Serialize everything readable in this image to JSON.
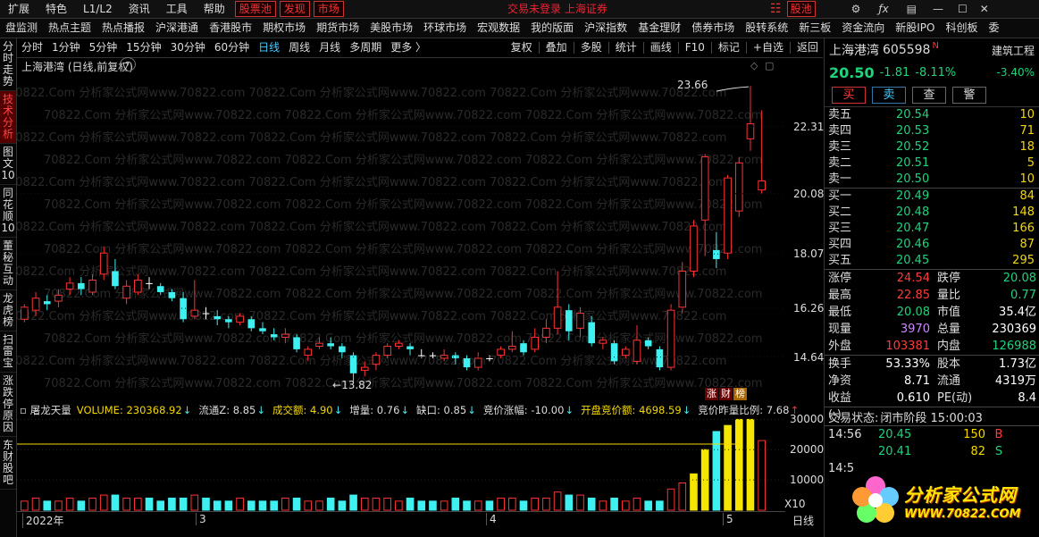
{
  "menu": {
    "items": [
      "扩展",
      "特色",
      "L1/L2",
      "资讯",
      "工具",
      "帮助"
    ],
    "boxed": [
      "股票池",
      "发现",
      "市场"
    ],
    "center_status": "交易未登录  上海证券",
    "right_label": "股池"
  },
  "nav": [
    "盘监测",
    "热点主题",
    "热点播报",
    "沪深港通",
    "香港股市",
    "期权市场",
    "期货市场",
    "美股市场",
    "环球市场",
    "宏观数据",
    "我的版面",
    "沪深指数",
    "基金理财",
    "债券市场",
    "股转系统",
    "新三板",
    "资金流向",
    "新股IPO",
    "科创板",
    "委"
  ],
  "left_tabs": [
    "分时走势",
    "技术分析",
    "图文10",
    "同花顺10",
    "董秘互动",
    "龙虎榜",
    "扫雷宝",
    "涨跌停原因",
    "东财股吧"
  ],
  "toolbar": {
    "periods": [
      "分时",
      "1分钟",
      "5分钟",
      "15分钟",
      "30分钟",
      "60分钟",
      "日线",
      "周线",
      "月线",
      "多周期",
      "更多 〉"
    ],
    "selected": "日线",
    "actions": [
      "复权",
      "叠加",
      "多股",
      "统计",
      "画线",
      "F10",
      "标记",
      "+自选",
      "返回"
    ]
  },
  "chart": {
    "title": "上海港湾 (日线,前复权)",
    "high_label": "23.66",
    "low_label": "13.82",
    "price_ticks": [
      "22.31",
      "20.08",
      "18.07",
      "16.26",
      "14.64"
    ],
    "zct_badge": [
      "涨",
      "财",
      "榜"
    ],
    "indicator_name": "屠龙天量",
    "indicator_items": [
      {
        "text": "VOLUME: 230368.92",
        "color": "#f5d800",
        "arrow": "↓"
      },
      {
        "text": "流通Z: 8.85",
        "color": "#ddd",
        "arrow": "↓"
      },
      {
        "text": "成交额: 4.90",
        "color": "#f5d800",
        "arrow": "↓"
      },
      {
        "text": "增量: 0.76",
        "color": "#ddd",
        "arrow": "↓"
      },
      {
        "text": "缺口: 0.85",
        "color": "#ddd",
        "arrow": "↓"
      },
      {
        "text": "竞价涨幅: -10.00",
        "color": "#ddd",
        "arrow": "↓"
      },
      {
        "text": "开盘竞价额: 4698.59",
        "color": "#f5d800",
        "arrow": "↓"
      },
      {
        "text": "竞价昨量比例: 7.68",
        "color": "#ddd",
        "arrow": "↑"
      }
    ],
    "volume_ticks": [
      "30000",
      "20000",
      "10000"
    ],
    "volume_unit": "X10",
    "date_labels": [
      "2022年",
      "3",
      "4",
      "5"
    ],
    "period_label": "日线",
    "watermark": "70822.Com 分析家公式网www.70822.com"
  },
  "chart_data": {
    "type": "candlestick",
    "symbol": "上海港湾",
    "candles": [
      {
        "o": 15.9,
        "c": 16.3,
        "h": 16.4,
        "l": 15.8
      },
      {
        "o": 16.2,
        "c": 16.6,
        "h": 16.8,
        "l": 16.0
      },
      {
        "o": 16.5,
        "c": 16.4,
        "h": 16.7,
        "l": 16.2
      },
      {
        "o": 16.5,
        "c": 16.7,
        "h": 16.9,
        "l": 16.3
      },
      {
        "o": 16.9,
        "c": 17.1,
        "h": 17.3,
        "l": 16.7
      },
      {
        "o": 17.1,
        "c": 16.9,
        "h": 17.3,
        "l": 16.7
      },
      {
        "o": 16.8,
        "c": 17.2,
        "h": 17.4,
        "l": 16.7
      },
      {
        "o": 17.4,
        "c": 18.1,
        "h": 18.3,
        "l": 17.2
      },
      {
        "o": 17.5,
        "c": 17.0,
        "h": 17.9,
        "l": 16.9
      },
      {
        "o": 16.6,
        "c": 17.0,
        "h": 17.2,
        "l": 16.4
      },
      {
        "o": 16.8,
        "c": 17.2,
        "h": 17.4,
        "l": 16.7
      },
      {
        "o": 17.1,
        "c": 17.1,
        "h": 17.3,
        "l": 16.9
      },
      {
        "o": 17.0,
        "c": 16.8,
        "h": 17.1,
        "l": 16.7
      },
      {
        "o": 16.8,
        "c": 16.6,
        "h": 16.9,
        "l": 16.5
      },
      {
        "o": 16.6,
        "c": 15.9,
        "h": 16.8,
        "l": 15.8
      },
      {
        "o": 16.0,
        "c": 16.2,
        "h": 17.2,
        "l": 15.9
      },
      {
        "o": 16.1,
        "c": 16.1,
        "h": 16.3,
        "l": 15.9
      },
      {
        "o": 16.0,
        "c": 15.9,
        "h": 16.2,
        "l": 15.7
      },
      {
        "o": 15.9,
        "c": 15.8,
        "h": 16.0,
        "l": 15.6
      },
      {
        "o": 15.8,
        "c": 16.0,
        "h": 16.1,
        "l": 15.7
      },
      {
        "o": 15.9,
        "c": 15.6,
        "h": 16.0,
        "l": 15.5
      },
      {
        "o": 15.6,
        "c": 15.5,
        "h": 15.8,
        "l": 15.4
      },
      {
        "o": 15.4,
        "c": 15.3,
        "h": 15.6,
        "l": 15.2
      },
      {
        "o": 15.3,
        "c": 15.4,
        "h": 15.6,
        "l": 15.1
      },
      {
        "o": 15.3,
        "c": 14.9,
        "h": 15.4,
        "l": 14.8
      },
      {
        "o": 14.7,
        "c": 14.9,
        "h": 15.0,
        "l": 14.5
      },
      {
        "o": 15.0,
        "c": 15.1,
        "h": 15.3,
        "l": 14.9
      },
      {
        "o": 15.1,
        "c": 15.0,
        "h": 15.3,
        "l": 14.9
      },
      {
        "o": 15.0,
        "c": 14.8,
        "h": 15.1,
        "l": 14.6
      },
      {
        "o": 14.7,
        "c": 14.1,
        "h": 14.8,
        "l": 13.82
      },
      {
        "o": 14.2,
        "c": 14.3,
        "h": 14.5,
        "l": 14.0
      },
      {
        "o": 14.4,
        "c": 14.7,
        "h": 14.8,
        "l": 14.2
      },
      {
        "o": 14.7,
        "c": 15.0,
        "h": 15.1,
        "l": 14.6
      },
      {
        "o": 15.0,
        "c": 15.1,
        "h": 15.2,
        "l": 14.9
      },
      {
        "o": 15.0,
        "c": 14.9,
        "h": 15.1,
        "l": 14.7
      },
      {
        "o": 14.7,
        "c": 14.7,
        "h": 14.9,
        "l": 14.6
      },
      {
        "o": 14.7,
        "c": 14.7,
        "h": 14.8,
        "l": 14.6
      },
      {
        "o": 14.6,
        "c": 14.7,
        "h": 14.9,
        "l": 14.5
      },
      {
        "o": 14.7,
        "c": 14.6,
        "h": 14.8,
        "l": 14.4
      },
      {
        "o": 14.6,
        "c": 14.3,
        "h": 14.7,
        "l": 14.2
      },
      {
        "o": 14.3,
        "c": 14.6,
        "h": 14.8,
        "l": 14.2
      },
      {
        "o": 14.6,
        "c": 14.6,
        "h": 14.7,
        "l": 14.5
      },
      {
        "o": 14.7,
        "c": 14.9,
        "h": 15.0,
        "l": 14.6
      },
      {
        "o": 14.9,
        "c": 15.0,
        "h": 15.5,
        "l": 14.8
      },
      {
        "o": 15.1,
        "c": 14.8,
        "h": 15.2,
        "l": 14.7
      },
      {
        "o": 14.9,
        "c": 15.3,
        "h": 15.6,
        "l": 14.8
      },
      {
        "o": 15.3,
        "c": 15.6,
        "h": 15.9,
        "l": 15.1
      },
      {
        "o": 15.6,
        "c": 16.3,
        "h": 17.5,
        "l": 15.4
      },
      {
        "o": 16.2,
        "c": 15.5,
        "h": 16.4,
        "l": 15.2
      },
      {
        "o": 15.6,
        "c": 16.1,
        "h": 16.3,
        "l": 15.3
      },
      {
        "o": 15.8,
        "c": 15.1,
        "h": 16.0,
        "l": 15.0
      },
      {
        "o": 15.1,
        "c": 15.2,
        "h": 15.3,
        "l": 14.9
      },
      {
        "o": 15.1,
        "c": 14.5,
        "h": 15.2,
        "l": 14.4
      },
      {
        "o": 14.7,
        "c": 14.9,
        "h": 15.0,
        "l": 14.6
      },
      {
        "o": 14.5,
        "c": 15.2,
        "h": 15.7,
        "l": 14.4
      },
      {
        "o": 15.2,
        "c": 15.0,
        "h": 15.3,
        "l": 14.9
      },
      {
        "o": 14.9,
        "c": 14.3,
        "h": 15.0,
        "l": 14.2
      },
      {
        "o": 14.3,
        "c": 16.2,
        "h": 16.4,
        "l": 14.2
      },
      {
        "o": 16.3,
        "c": 17.5,
        "h": 17.8,
        "l": 16.1
      },
      {
        "o": 17.5,
        "c": 19.0,
        "h": 19.2,
        "l": 17.3
      },
      {
        "o": 19.2,
        "c": 21.3,
        "h": 21.4,
        "l": 18.0
      },
      {
        "o": 18.2,
        "c": 17.9,
        "h": 18.8,
        "l": 17.6
      },
      {
        "o": 18.1,
        "c": 20.6,
        "h": 20.7,
        "l": 17.9
      },
      {
        "o": 19.5,
        "c": 21.1,
        "h": 21.3,
        "l": 19.3
      },
      {
        "o": 21.9,
        "c": 22.4,
        "h": 23.66,
        "l": 21.5
      },
      {
        "o": 20.2,
        "c": 20.5,
        "h": 22.85,
        "l": 20.08
      }
    ],
    "volume": [
      3,
      4,
      3,
      3,
      4,
      3,
      4,
      5,
      5,
      4,
      4,
      4,
      3,
      4,
      4,
      5,
      4,
      3,
      3,
      4,
      3,
      3,
      3,
      4,
      4,
      3,
      3,
      4,
      3,
      5,
      4,
      4,
      4,
      3,
      4,
      3,
      3,
      3,
      4,
      3,
      3,
      3,
      4,
      4,
      3,
      4,
      4,
      6,
      5,
      5,
      4,
      3,
      4,
      3,
      4,
      3,
      3,
      7,
      9,
      12,
      20,
      26,
      28,
      30,
      30,
      23
    ],
    "volume_ticks": [
      30000,
      20000,
      10000
    ],
    "price_ticks": [
      22.31,
      20.08,
      18.07,
      16.26,
      14.64
    ]
  },
  "quote": {
    "name": "上海港湾",
    "code": "605598",
    "badge": "N",
    "industry": "建筑工程",
    "price": "20.50",
    "change": "-1.81",
    "change_pct": "-8.11%",
    "industry_pct": "-3.40%",
    "buttons": [
      "买",
      "卖",
      "查",
      "警"
    ],
    "asks": [
      {
        "label": "卖五",
        "price": "20.54",
        "vol": "10"
      },
      {
        "label": "卖四",
        "price": "20.53",
        "vol": "71"
      },
      {
        "label": "卖三",
        "price": "20.52",
        "vol": "18"
      },
      {
        "label": "卖二",
        "price": "20.51",
        "vol": "5"
      },
      {
        "label": "卖一",
        "price": "20.50",
        "vol": "10"
      }
    ],
    "bids": [
      {
        "label": "买一",
        "price": "20.49",
        "vol": "84"
      },
      {
        "label": "买二",
        "price": "20.48",
        "vol": "148"
      },
      {
        "label": "买三",
        "price": "20.47",
        "vol": "166"
      },
      {
        "label": "买四",
        "price": "20.46",
        "vol": "87"
      },
      {
        "label": "买五",
        "price": "20.45",
        "vol": "295"
      }
    ],
    "stats1": [
      {
        "k": "涨停",
        "v": "24.54",
        "vc": "#ff3b3b",
        "k2": "跌停",
        "v2": "20.08",
        "v2c": "#1fd37c"
      },
      {
        "k": "最高",
        "v": "22.85",
        "vc": "#ff3b3b",
        "k2": "量比",
        "v2": "0.77",
        "v2c": "#1fd37c"
      },
      {
        "k": "最低",
        "v": "20.08",
        "vc": "#1fd37c",
        "k2": "市值",
        "v2": "35.4亿",
        "v2c": "#fff"
      },
      {
        "k": "现量",
        "v": "3970",
        "vc": "#c8f",
        "k2": "总量",
        "v2": "230369",
        "v2c": "#fff"
      },
      {
        "k": "外盘",
        "v": "103381",
        "vc": "#ff3b3b",
        "k2": "内盘",
        "v2": "126988",
        "v2c": "#1fd37c"
      }
    ],
    "stats2": [
      {
        "k": "换手",
        "v": "53.33%",
        "vc": "#fff",
        "k2": "股本",
        "v2": "1.73亿",
        "v2c": "#fff"
      },
      {
        "k": "净资",
        "v": "8.71",
        "vc": "#fff",
        "k2": "流通",
        "v2": "4319万",
        "v2c": "#fff"
      },
      {
        "k": "收益(-)",
        "v": "0.610",
        "vc": "#fff",
        "k2": "PE(动)",
        "v2": "8.4",
        "v2c": "#fff"
      }
    ],
    "trade_state_label": "交易状态:",
    "trade_state": "闭市阶段 15:00:03",
    "ticks": [
      {
        "time": "14:56",
        "price": "20.45",
        "vol": "150",
        "side": "B",
        "side_color": "#ff3b3b"
      },
      {
        "time": "",
        "price": "20.41",
        "vol": "82",
        "side": "S",
        "side_color": "#1fd37c"
      },
      {
        "time": "14:5",
        "price": "",
        "vol": "",
        "side": "",
        "side_color": "#fff"
      }
    ]
  },
  "watermark_logo": {
    "title": "分析家公式网",
    "url": "WWW.70822.COM"
  }
}
